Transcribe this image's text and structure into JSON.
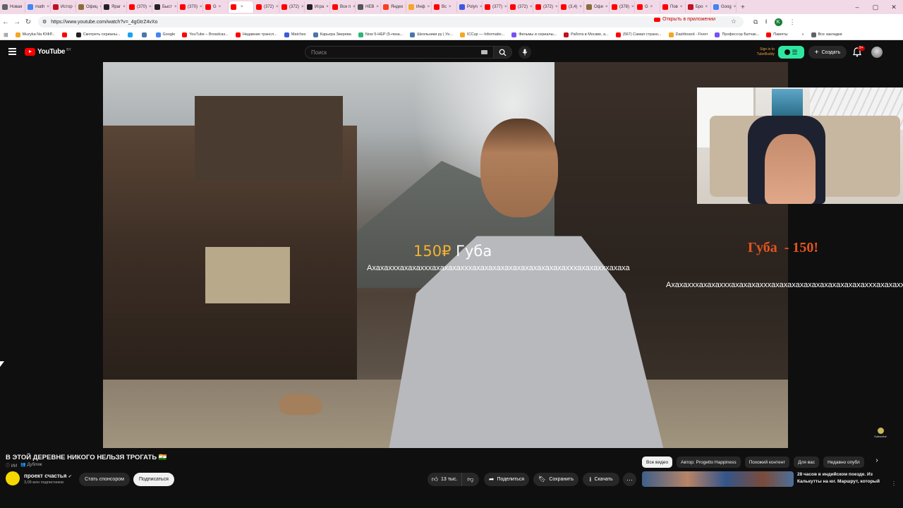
{
  "browser": {
    "tabs": [
      {
        "label": "Новая",
        "color": "#5f6368",
        "active": false
      },
      {
        "label": "math",
        "color": "#4285f4",
        "active": false
      },
      {
        "label": "Истор",
        "color": "#c1121f",
        "active": false
      },
      {
        "label": "Офиц",
        "color": "#8a6d3b",
        "active": false
      },
      {
        "label": "Яраг",
        "color": "#222222",
        "active": false
      },
      {
        "label": "(370)",
        "color": "#ff0000",
        "active": false
      },
      {
        "label": "Быст",
        "color": "#222222",
        "active": false
      },
      {
        "label": "(370)",
        "color": "#ff0000",
        "active": false
      },
      {
        "label": "G",
        "color": "#ff0000",
        "active": false
      },
      {
        "label": "",
        "color": "#ff0000",
        "active": true
      },
      {
        "label": "(372)",
        "color": "#ff0000",
        "active": false
      },
      {
        "label": "(372)",
        "color": "#ff0000",
        "active": false
      },
      {
        "label": "Игра",
        "color": "#222222",
        "active": false
      },
      {
        "label": "Все п",
        "color": "#ff0000",
        "active": false
      },
      {
        "label": "НЕВ",
        "color": "#555555",
        "active": false
      },
      {
        "label": "Яндек",
        "color": "#fc3f1d",
        "active": false
      },
      {
        "label": "Инф",
        "color": "#f5a623",
        "active": false
      },
      {
        "label": "Вс",
        "color": "#ff0000",
        "active": false
      },
      {
        "label": "Polyn",
        "color": "#3b5bdb",
        "active": false
      },
      {
        "label": "(377)",
        "color": "#ff0000",
        "active": false
      },
      {
        "label": "(372)",
        "color": "#ff0000",
        "active": false
      },
      {
        "label": "(372)",
        "color": "#ff0000",
        "active": false
      },
      {
        "label": "(3,4)",
        "color": "#ff0000",
        "active": false
      },
      {
        "label": "Офи",
        "color": "#8a6d3b",
        "active": false
      },
      {
        "label": "(378)",
        "color": "#ff0000",
        "active": false
      },
      {
        "label": "G",
        "color": "#ff0000",
        "active": false
      },
      {
        "label": "Пов",
        "color": "#ff0000",
        "active": false
      },
      {
        "label": "Бро",
        "color": "#c1121f",
        "active": false
      },
      {
        "label": "Goog",
        "color": "#4285f4",
        "active": false
      }
    ],
    "new_tab": "+",
    "window_controls": {
      "minimize": "–",
      "maximize": "▢",
      "close": "✕"
    },
    "url": "https://www.youtube.com/watch?v=_4gGtrZ4vXo",
    "open_in_app": "Открыть в приложении",
    "profile_letter": "K",
    "bookmarks": [
      {
        "label": "Muzyka Na ЮФР...",
        "color": "#f5a623"
      },
      {
        "label": "",
        "color": "#ff0000"
      },
      {
        "label": "Смотреть сериалы...",
        "color": "#222222"
      },
      {
        "label": "",
        "color": "#1da1f2"
      },
      {
        "label": "",
        "color": "#4a76a8"
      },
      {
        "label": "Google",
        "color": "#4285f4"
      },
      {
        "label": "YouTube – Broadcas...",
        "color": "#ff0000"
      },
      {
        "label": "Недавние трансл...",
        "color": "#ff0000"
      },
      {
        "label": "Matches",
        "color": "#3b5bdb"
      },
      {
        "label": "Карьера Зверева",
        "color": "#4a76a8"
      },
      {
        "label": "Now 5-НЕР (5-лиза...",
        "color": "#2bb673"
      },
      {
        "label": "Школьники ру | Ун...",
        "color": "#4a76a8"
      },
      {
        "label": "ICCup — Informatio...",
        "color": "#f5a623"
      },
      {
        "label": "Фильмы и сериалы...",
        "color": "#7950f2"
      },
      {
        "label": "Работа в Москве, а...",
        "color": "#c1121f"
      },
      {
        "label": "(567) Самая странн...",
        "color": "#ff0000"
      },
      {
        "label": "Dashboard - Fiverr",
        "color": "#f5a623"
      },
      {
        "label": "Профессор Батчак...",
        "color": "#7950f2"
      },
      {
        "label": "Памяты",
        "color": "#ff0000"
      },
      {
        "label": "»",
        "color": "#ffffff"
      },
      {
        "label": "Все закладки",
        "color": "#5f6368"
      }
    ]
  },
  "youtube": {
    "logo_text": "YouTube",
    "region": "BY",
    "search_placeholder": "Поиск",
    "sign_in_line1": "Sign in to",
    "sign_in_line2": "TubeBuddy",
    "create_label": "Создать",
    "notifications_count": "9+"
  },
  "video": {
    "overlay_price": "150₽",
    "overlay_word": "Губа",
    "overlay_laugh": "Ахахахххахахахххахахахахххахахахахахахахахахахахахххахахахххахаха",
    "side_text": "Губа  - 150!",
    "side_laugh": "Ахахахххахахахххахахахахххахахахахахахахахахахахахххахахахххахахахааха",
    "subscribe_watermark": "Subscribe",
    "title": "В ЭТОЙ ДЕРЕВНЕ НИКОГО НЕЛЬЗЯ ТРОГАТЬ 🇮🇳",
    "meta_ai": "ИИ",
    "meta_dub": "Дубляж",
    "channel_name": "проект счастья",
    "channel_subs": "3,09 млн подписчиков",
    "sponsor_label": "Стать спонсором",
    "subscribe_label": "Подписаться",
    "likes": "13 тыс.",
    "share_label": "Поделиться",
    "save_label": "Сохранить",
    "download_label": "Скачать"
  },
  "recommendations": {
    "chips": [
      "Все видео",
      "Автор: Progetto Happiness",
      "Похожий контент",
      "Для вас",
      "Недавно опубл"
    ],
    "first_title": "28 часов в индийском поезде. Из Калькутты на юг. Маршрут, который"
  }
}
